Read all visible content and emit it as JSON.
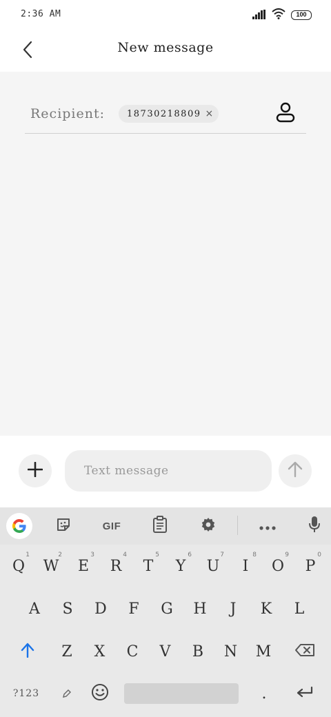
{
  "status_bar": {
    "time": "2:36 AM",
    "battery": "100"
  },
  "header": {
    "title": "New message"
  },
  "recipient": {
    "label": "Recipient:",
    "chip": "18730218809",
    "chip_close": "×"
  },
  "compose": {
    "placeholder": "Text message"
  },
  "toolbar": {
    "gif_label": "GIF"
  },
  "keyboard": {
    "row1": [
      {
        "k": "Q",
        "h": "1"
      },
      {
        "k": "W",
        "h": "2"
      },
      {
        "k": "E",
        "h": "3"
      },
      {
        "k": "R",
        "h": "4"
      },
      {
        "k": "T",
        "h": "5"
      },
      {
        "k": "Y",
        "h": "6"
      },
      {
        "k": "U",
        "h": "7"
      },
      {
        "k": "I",
        "h": "8"
      },
      {
        "k": "O",
        "h": "9"
      },
      {
        "k": "P",
        "h": "0"
      }
    ],
    "row2": [
      "A",
      "S",
      "D",
      "F",
      "G",
      "H",
      "J",
      "K",
      "L"
    ],
    "row3": [
      "Z",
      "X",
      "C",
      "V",
      "B",
      "N",
      "M"
    ],
    "symbols_label": "?123",
    "period_label": "."
  },
  "colors": {
    "accent_blue": "#1a73e8",
    "keyboard_bg": "#e9e9e9",
    "content_bg": "#f5f5f5"
  }
}
